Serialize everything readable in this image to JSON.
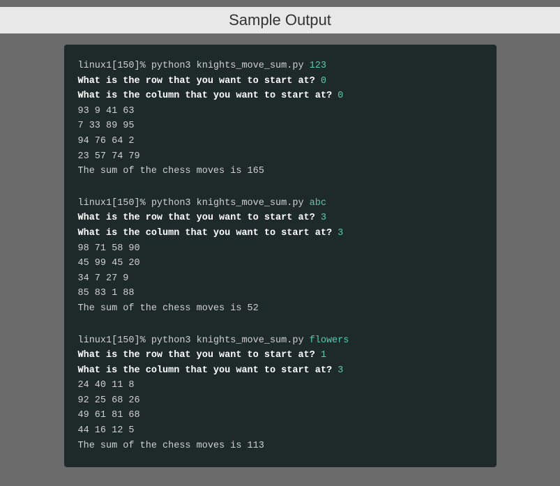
{
  "page": {
    "title": "Sample Output"
  },
  "terminal": {
    "blocks": [
      {
        "id": "block1",
        "command": {
          "prompt": "linux1[150]% python3 knights_move_sum.py ",
          "arg": "123"
        },
        "inputs": [
          {
            "label": "What is the row that you want to start at? ",
            "value": "0"
          },
          {
            "label": "What is the column that you want to start at? ",
            "value": "0"
          }
        ],
        "data_lines": [
          "93 9 41 63",
          "7 33 89 95",
          "94 76 64 2",
          "23 57 74 79"
        ],
        "result": "The sum of the chess moves is 165"
      },
      {
        "id": "block2",
        "command": {
          "prompt": "linux1[150]% python3 knights_move_sum.py ",
          "arg": "abc"
        },
        "inputs": [
          {
            "label": "What is the row that you want to start at? ",
            "value": "3"
          },
          {
            "label": "What is the column that you want to start at? ",
            "value": "3"
          }
        ],
        "data_lines": [
          "98 71 58 90",
          "45 99 45 20",
          "34 7 27 9",
          "85 83 1 88"
        ],
        "result": "The sum of the chess moves is 52"
      },
      {
        "id": "block3",
        "command": {
          "prompt": "linux1[150]% python3 knights_move_sum.py ",
          "arg": "flowers"
        },
        "inputs": [
          {
            "label": "What is the row that you want to start at? ",
            "value": "1"
          },
          {
            "label": "What is the column that you want to start at? ",
            "value": "3"
          }
        ],
        "data_lines": [
          "24 40 11 8",
          "92 25 68 26",
          "49 61 81 68",
          "44 16 12 5"
        ],
        "result": "The sum of the chess moves is 113"
      }
    ]
  }
}
